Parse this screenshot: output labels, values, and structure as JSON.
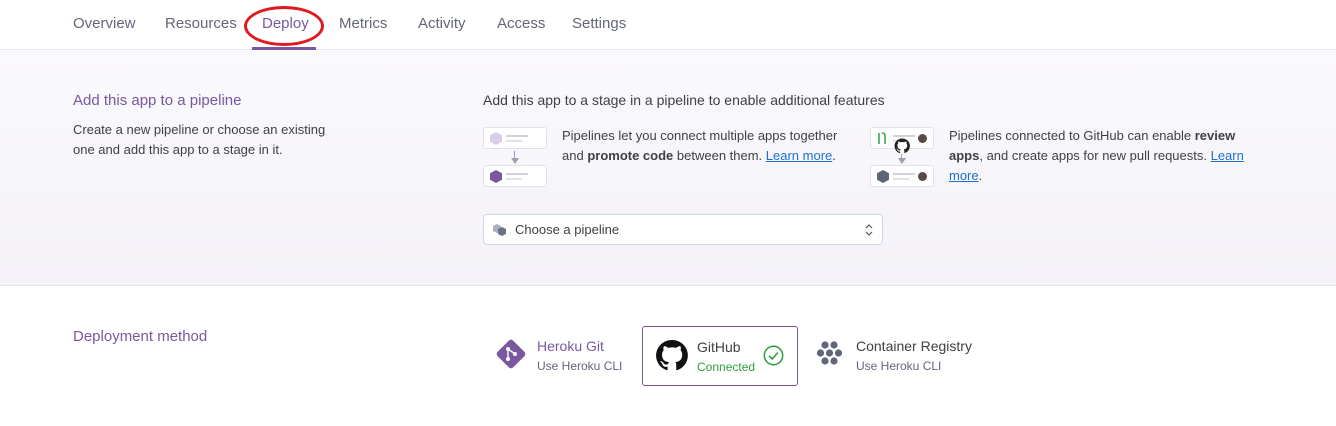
{
  "tabs": [
    {
      "label": "Overview"
    },
    {
      "label": "Resources"
    },
    {
      "label": "Deploy"
    },
    {
      "label": "Metrics"
    },
    {
      "label": "Activity"
    },
    {
      "label": "Access"
    },
    {
      "label": "Settings"
    }
  ],
  "active_tab": "Deploy",
  "colors": {
    "accent": "#79589f",
    "link": "#1f6fd0",
    "connected": "#2e9e3b",
    "annotation": "#e0191e"
  },
  "pipeline": {
    "title": "Add this app to a pipeline",
    "description": "Create a new pipeline or choose an existing one and add this app to a stage in it.",
    "heading": "Add this app to a stage in a pipeline to enable additional features",
    "feature1": {
      "text_a": "Pipelines let you connect multiple apps together and ",
      "bold": "promote code",
      "text_b": " between them. ",
      "link": "Learn more",
      "end": "."
    },
    "feature2": {
      "text_a": "Pipelines connected to GitHub can enable ",
      "bold": "review apps",
      "text_b": ", and create apps for new pull requests. ",
      "link": "Learn more",
      "end": "."
    },
    "select_placeholder": "Choose a pipeline"
  },
  "deployment": {
    "title": "Deployment method",
    "methods": [
      {
        "name": "Heroku Git",
        "sub": "Use Heroku CLI",
        "icon": "git-icon"
      },
      {
        "name": "GitHub",
        "sub": "Connected",
        "icon": "github-icon",
        "selected": true,
        "status_icon": "check-circle-icon"
      },
      {
        "name": "Container Registry",
        "sub": "Use Heroku CLI",
        "icon": "container-registry-icon"
      }
    ]
  }
}
